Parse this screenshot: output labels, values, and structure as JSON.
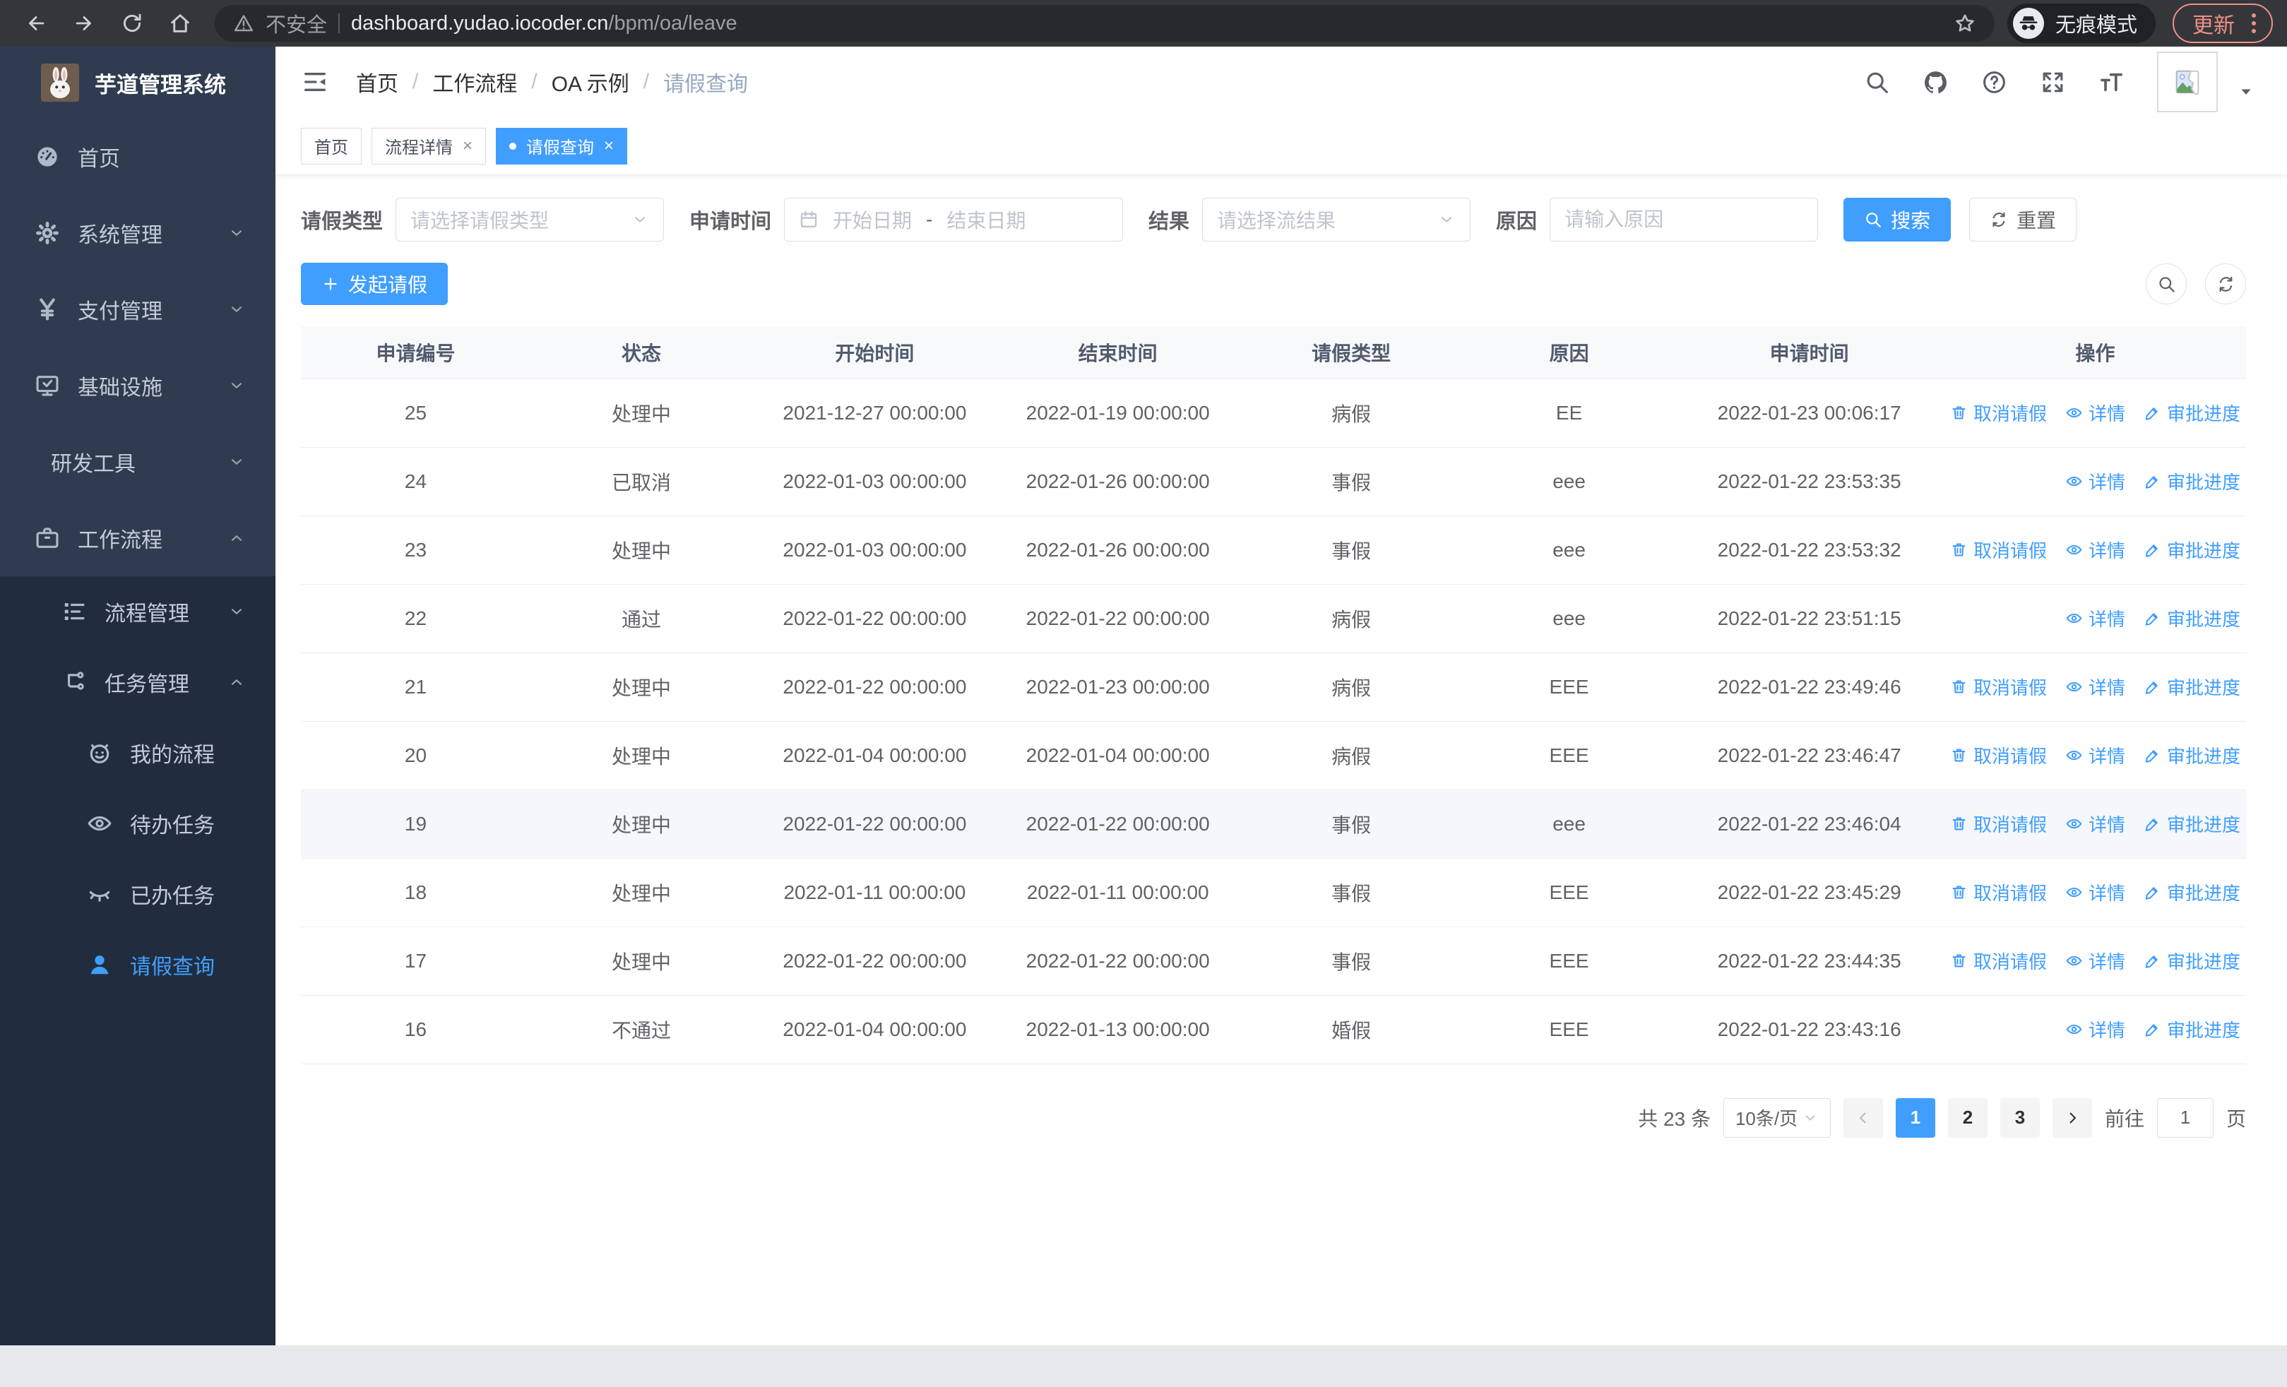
{
  "browser": {
    "security_label": "不安全",
    "url_host": "dashboard.yudao.iocoder.cn",
    "url_path": "/bpm/oa/leave",
    "incognito_label": "无痕模式",
    "update_label": "更新"
  },
  "sidebar": {
    "title": "芋道管理系统",
    "items_top": [
      {
        "key": "home",
        "label": "首页",
        "icon": "dashboard-icon"
      },
      {
        "key": "system",
        "label": "系统管理",
        "icon": "gear-icon",
        "chevron": "down"
      },
      {
        "key": "payment",
        "label": "支付管理",
        "icon": "yen-icon",
        "chevron": "down"
      },
      {
        "key": "infra",
        "label": "基础设施",
        "icon": "monitor-icon",
        "chevron": "down"
      },
      {
        "key": "devtools",
        "label": "研发工具",
        "icon": "toolbox-icon",
        "chevron": "down"
      },
      {
        "key": "workflow",
        "label": "工作流程",
        "icon": "briefcase-icon",
        "chevron": "up"
      }
    ],
    "items_sub": [
      {
        "key": "process-mgmt",
        "label": "流程管理",
        "icon": "flow-list-icon",
        "chevron": "down",
        "level": 2
      },
      {
        "key": "task-mgmt",
        "label": "任务管理",
        "icon": "org-icon",
        "chevron": "up",
        "level": 2
      },
      {
        "key": "my-process",
        "label": "我的流程",
        "icon": "robot-icon",
        "level": 3
      },
      {
        "key": "todo-task",
        "label": "待办任务",
        "icon": "eye-icon",
        "level": 3
      },
      {
        "key": "done-task",
        "label": "已办任务",
        "icon": "eye-closed-icon",
        "level": 3
      },
      {
        "key": "leave-query",
        "label": "请假查询",
        "icon": "user-icon",
        "level": 3,
        "active": true
      }
    ]
  },
  "breadcrumb": {
    "items": [
      "首页",
      "工作流程",
      "OA 示例"
    ],
    "current": "请假查询"
  },
  "tabs": [
    {
      "key": "home",
      "label": "首页",
      "closable": false,
      "active": false
    },
    {
      "key": "process-detail",
      "label": "流程详情",
      "closable": true,
      "active": false
    },
    {
      "key": "leave-query",
      "label": "请假查询",
      "closable": true,
      "active": true
    }
  ],
  "filters": {
    "leave_type_label": "请假类型",
    "leave_type_placeholder": "请选择请假类型",
    "apply_time_label": "申请时间",
    "start_placeholder": "开始日期",
    "range_separator": "-",
    "end_placeholder": "结束日期",
    "result_label": "结果",
    "result_placeholder": "请选择流结果",
    "reason_label": "原因",
    "reason_placeholder": "请输入原因",
    "search_label": "搜索",
    "reset_label": "重置"
  },
  "toolbar": {
    "create_label": "发起请假"
  },
  "table": {
    "headers": [
      "申请编号",
      "状态",
      "开始时间",
      "结束时间",
      "请假类型",
      "原因",
      "申请时间",
      "操作"
    ],
    "col_widths": [
      11.8,
      11.4,
      12.6,
      12.4,
      11.6,
      10.8,
      13.9,
      15.5
    ],
    "action_defs": {
      "cancel": {
        "label": "取消请假",
        "icon": "delete-icon"
      },
      "detail": {
        "label": "详情",
        "icon": "view-icon"
      },
      "progress": {
        "label": "审批进度",
        "icon": "edit-icon"
      }
    },
    "rows": [
      {
        "id": "25",
        "status": "处理中",
        "start": "2021-12-27 00:00:00",
        "end": "2022-01-19 00:00:00",
        "type": "病假",
        "reason": "EE",
        "apply_time": "2022-01-23 00:06:17",
        "actions": [
          "cancel",
          "detail",
          "progress"
        ]
      },
      {
        "id": "24",
        "status": "已取消",
        "start": "2022-01-03 00:00:00",
        "end": "2022-01-26 00:00:00",
        "type": "事假",
        "reason": "eee",
        "apply_time": "2022-01-22 23:53:35",
        "actions": [
          "detail",
          "progress"
        ]
      },
      {
        "id": "23",
        "status": "处理中",
        "start": "2022-01-03 00:00:00",
        "end": "2022-01-26 00:00:00",
        "type": "事假",
        "reason": "eee",
        "apply_time": "2022-01-22 23:53:32",
        "actions": [
          "cancel",
          "detail",
          "progress"
        ]
      },
      {
        "id": "22",
        "status": "通过",
        "start": "2022-01-22 00:00:00",
        "end": "2022-01-22 00:00:00",
        "type": "病假",
        "reason": "eee",
        "apply_time": "2022-01-22 23:51:15",
        "actions": [
          "detail",
          "progress"
        ]
      },
      {
        "id": "21",
        "status": "处理中",
        "start": "2022-01-22 00:00:00",
        "end": "2022-01-23 00:00:00",
        "type": "病假",
        "reason": "EEE",
        "apply_time": "2022-01-22 23:49:46",
        "actions": [
          "cancel",
          "detail",
          "progress"
        ]
      },
      {
        "id": "20",
        "status": "处理中",
        "start": "2022-01-04 00:00:00",
        "end": "2022-01-04 00:00:00",
        "type": "病假",
        "reason": "EEE",
        "apply_time": "2022-01-22 23:46:47",
        "actions": [
          "cancel",
          "detail",
          "progress"
        ]
      },
      {
        "id": "19",
        "status": "处理中",
        "start": "2022-01-22 00:00:00",
        "end": "2022-01-22 00:00:00",
        "type": "事假",
        "reason": "eee",
        "apply_time": "2022-01-22 23:46:04",
        "actions": [
          "cancel",
          "detail",
          "progress"
        ],
        "highlighted": true
      },
      {
        "id": "18",
        "status": "处理中",
        "start": "2022-01-11 00:00:00",
        "end": "2022-01-11 00:00:00",
        "type": "事假",
        "reason": "EEE",
        "apply_time": "2022-01-22 23:45:29",
        "actions": [
          "cancel",
          "detail",
          "progress"
        ]
      },
      {
        "id": "17",
        "status": "处理中",
        "start": "2022-01-22 00:00:00",
        "end": "2022-01-22 00:00:00",
        "type": "事假",
        "reason": "EEE",
        "apply_time": "2022-01-22 23:44:35",
        "actions": [
          "cancel",
          "detail",
          "progress"
        ]
      },
      {
        "id": "16",
        "status": "不通过",
        "start": "2022-01-04 00:00:00",
        "end": "2022-01-13 00:00:00",
        "type": "婚假",
        "reason": "EEE",
        "apply_time": "2022-01-22 23:43:16",
        "actions": [
          "detail",
          "progress"
        ]
      }
    ]
  },
  "pagination": {
    "total_label": "共 23 条",
    "page_size_label": "10条/页",
    "pages": [
      "1",
      "2",
      "3"
    ],
    "current_page": "1",
    "goto_label": "前往",
    "goto_value": "1",
    "page_unit_label": "页"
  },
  "colors": {
    "primary": "#409eff",
    "update_accent": "#ee9088",
    "sidebar_bg": "#2f3c4f",
    "submenu_bg": "#212d3e"
  }
}
